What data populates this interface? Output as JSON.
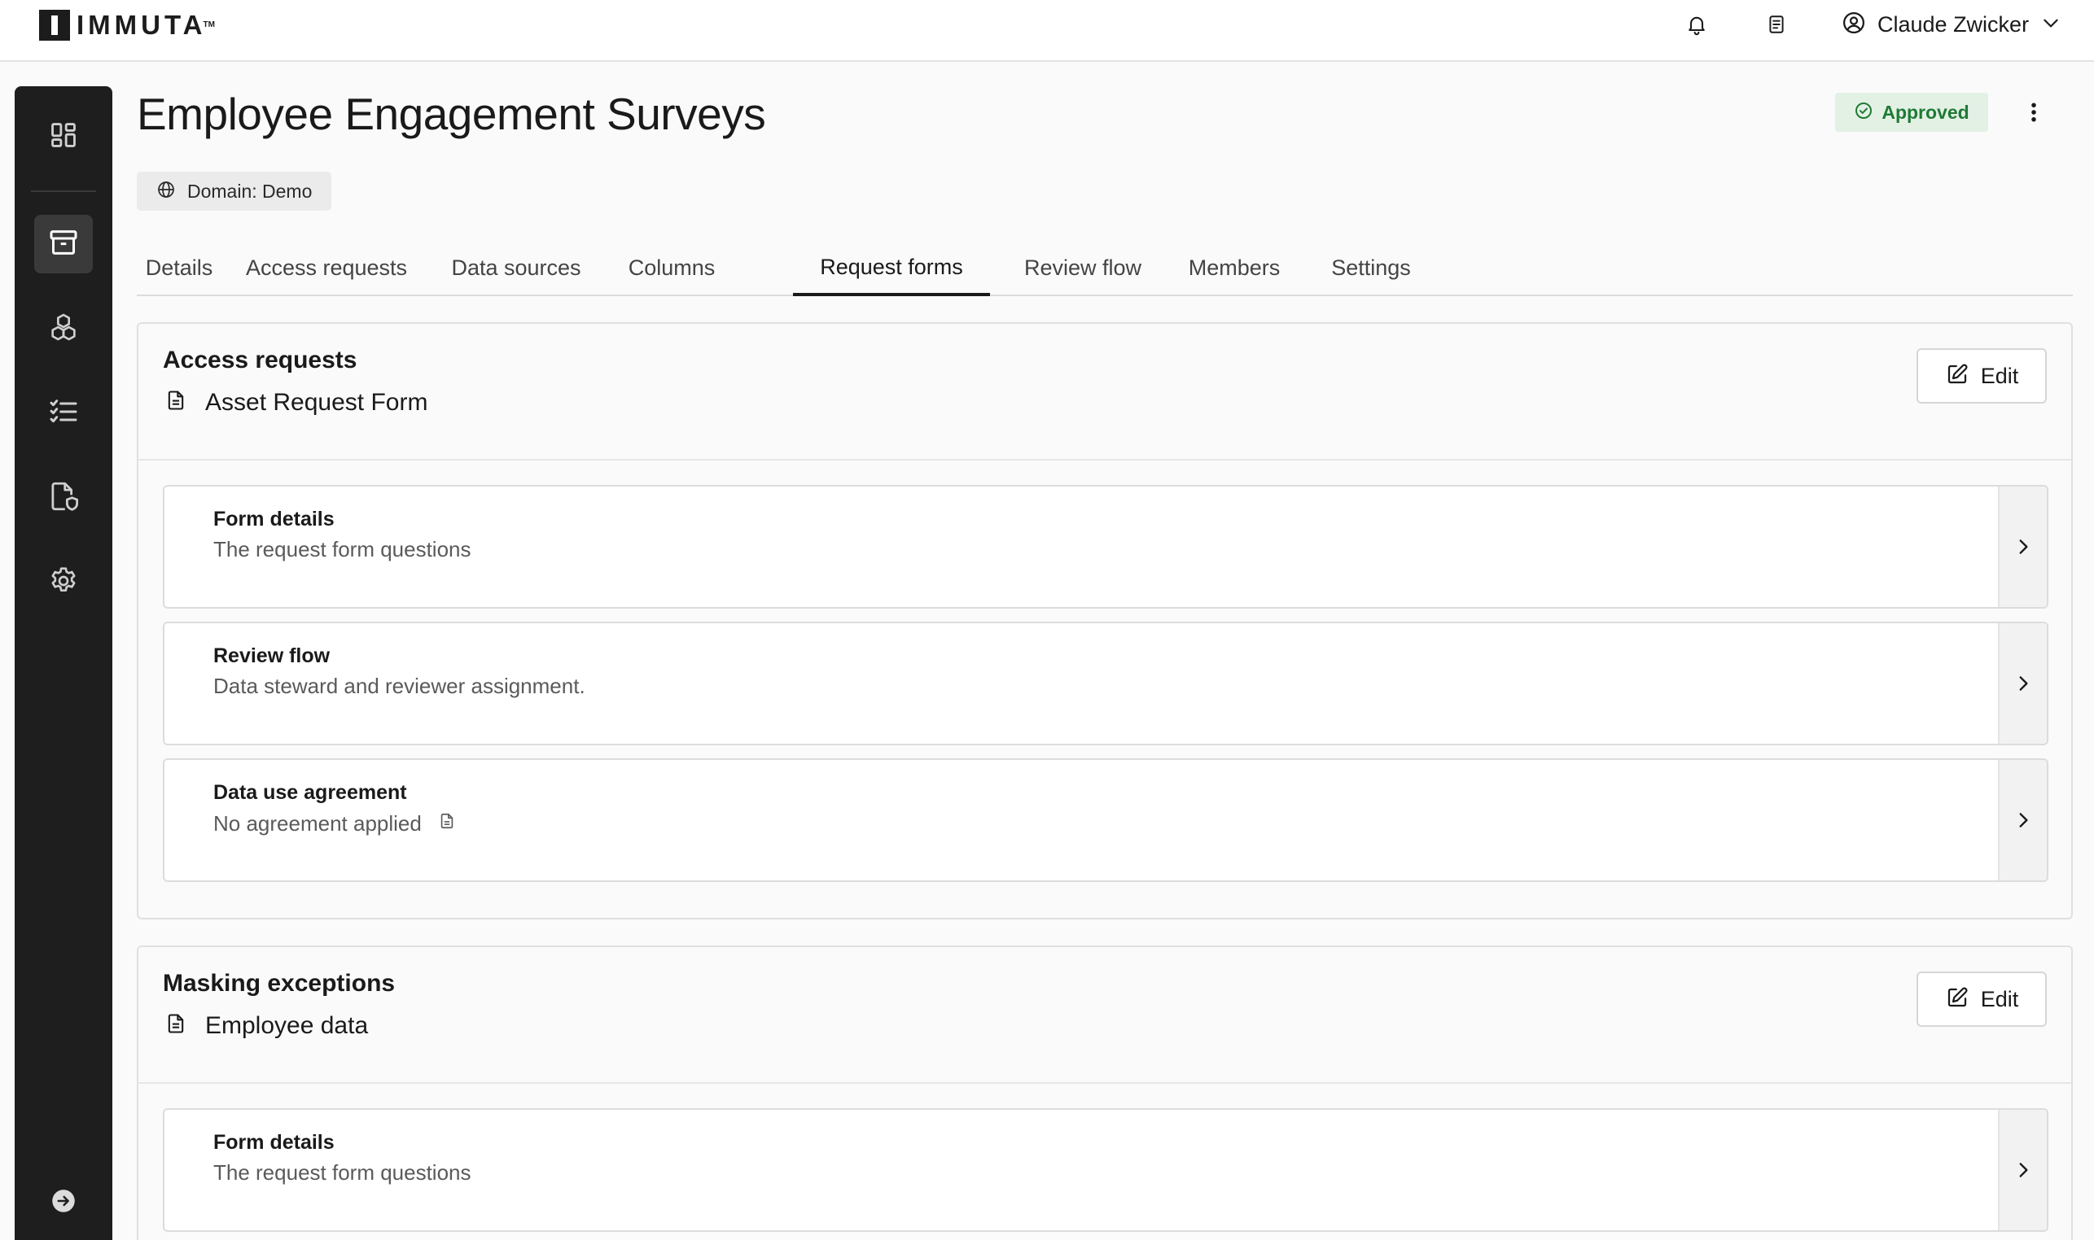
{
  "brand": {
    "name": "IMMUTA",
    "trademark": "TM"
  },
  "topbar": {
    "notifications_icon": "bell-icon",
    "docs_icon": "document-list-icon",
    "user": {
      "name": "Claude Zwicker",
      "icon": "user-circle-icon",
      "menu_icon": "chevron-down-icon"
    }
  },
  "sidebar": {
    "items": [
      {
        "id": "dashboard",
        "icon": "dashboard-grid-icon",
        "active": false
      },
      {
        "id": "data-products",
        "icon": "archive-box-icon",
        "active": true
      },
      {
        "id": "domains",
        "icon": "cubes-icon",
        "active": false
      },
      {
        "id": "requests",
        "icon": "checklist-icon",
        "active": false
      },
      {
        "id": "policies",
        "icon": "document-shield-icon",
        "active": false
      },
      {
        "id": "settings",
        "icon": "gear-icon",
        "active": false
      }
    ],
    "collapse_icon": "arrow-right-circle-icon"
  },
  "header": {
    "title": "Employee Engagement Surveys",
    "status": {
      "label": "Approved",
      "icon": "check-circle-icon",
      "color": "#1f7a35"
    },
    "more_icon": "more-vertical-icon",
    "domain_chip": {
      "label": "Domain: Demo",
      "icon": "globe-icon"
    }
  },
  "tabs": [
    {
      "label": "Details",
      "active": false
    },
    {
      "label": "Access requests",
      "active": false
    },
    {
      "label": "Data sources",
      "active": false
    },
    {
      "label": "Columns",
      "active": false
    },
    {
      "label": "Request forms",
      "active": true
    },
    {
      "label": "Review flow",
      "active": false
    },
    {
      "label": "Members",
      "active": false
    },
    {
      "label": "Settings",
      "active": false
    }
  ],
  "sections": [
    {
      "title": "Access requests",
      "form_name": "Asset Request Form",
      "edit_label": "Edit",
      "cards": [
        {
          "title": "Form details",
          "subtitle": "The request form questions"
        },
        {
          "title": "Review flow",
          "subtitle": "Data steward and reviewer assignment."
        },
        {
          "title": "Data use agreement",
          "subtitle": "No agreement applied"
        }
      ]
    },
    {
      "title": "Masking exceptions",
      "form_name": "Employee data",
      "edit_label": "Edit",
      "cards": [
        {
          "title": "Form details",
          "subtitle": "The request form questions"
        }
      ]
    }
  ]
}
